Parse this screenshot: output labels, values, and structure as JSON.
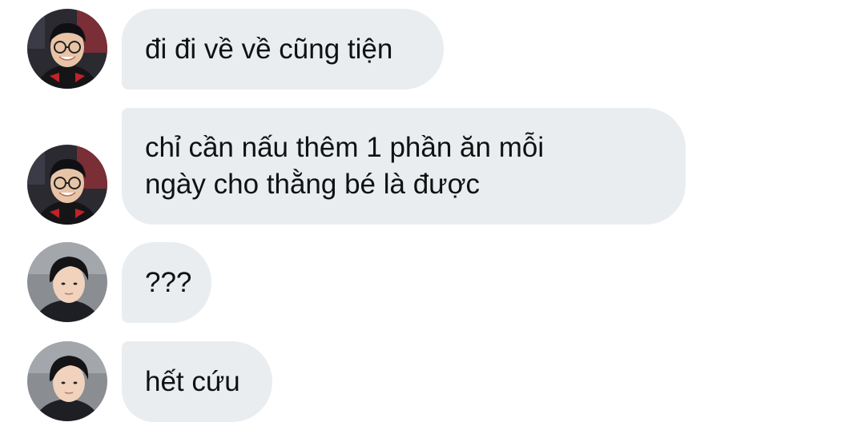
{
  "messages": [
    {
      "sender": "user-a",
      "text": "đi đi về về cũng tiện"
    },
    {
      "sender": "user-a",
      "text": "chỉ cần nấu thêm 1 phần ăn mỗi\nngày cho thằng bé là được"
    },
    {
      "sender": "user-b",
      "text": "???"
    },
    {
      "sender": "user-b",
      "text": "hết cứu"
    }
  ],
  "colors": {
    "bubble_bg": "#e9edf0",
    "text": "#111111",
    "background": "#ffffff"
  }
}
